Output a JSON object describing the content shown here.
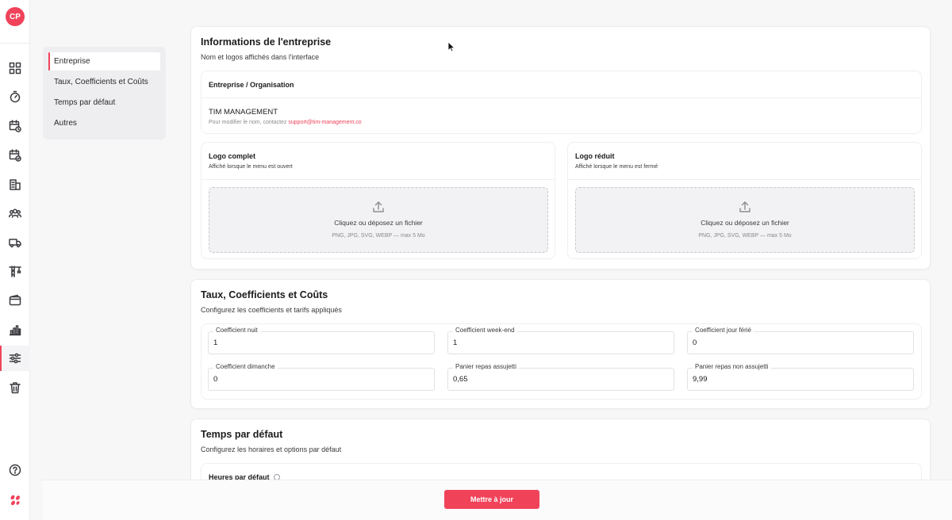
{
  "user": {
    "initials": "CP"
  },
  "rail": {
    "icons": [
      "dashboard-icon",
      "timer-icon",
      "calendar-clock-icon",
      "calendar-check-icon",
      "building-icon",
      "team-icon",
      "truck-icon",
      "crane-icon",
      "wallet-icon",
      "chart-icon",
      "settings-sliders-icon",
      "trash-icon",
      "help-icon",
      "logo-icon"
    ],
    "active": "settings-sliders-icon"
  },
  "subnav": {
    "items": [
      {
        "label": "Entreprise",
        "active": true
      },
      {
        "label": "Taux, Coefficients et Coûts",
        "active": false
      },
      {
        "label": "Temps par défaut",
        "active": false
      },
      {
        "label": "Autres",
        "active": false
      }
    ]
  },
  "company": {
    "title": "Informations de l'entreprise",
    "subtitle": "Nom et logos affichés dans l'interface",
    "org_label": "Entreprise / Organisation",
    "org_name": "TIM MANAGEMENT",
    "contact_prefix": "Pour modifier le nom, contactez ",
    "contact_email": "support@tim-management.co",
    "logo_full": {
      "title": "Logo complet",
      "desc": "Affiché lorsque le menu est ouvert",
      "drop_text": "Cliquez ou déposez un fichier",
      "drop_hint": "PNG, JPG, SVG, WEBP — max 5 Mo"
    },
    "logo_small": {
      "title": "Logo réduit",
      "desc": "Affiché lorsque le menu est fermé",
      "drop_text": "Cliquez ou déposez un fichier",
      "drop_hint": "PNG, JPG, SVG, WEBP — max 5 Mo"
    }
  },
  "rates": {
    "title": "Taux, Coefficients et Coûts",
    "subtitle": "Configurez les coefficients et tarifs appliqués",
    "fields": [
      {
        "label": "Coefficient nuit",
        "value": "1"
      },
      {
        "label": "Coefficient week-end",
        "value": "1"
      },
      {
        "label": "Coefficient jour férié",
        "value": "0"
      },
      {
        "label": "Coefficient dimanche",
        "value": "0"
      },
      {
        "label": "Panier repas assujetti",
        "value": "0,65"
      },
      {
        "label": "Panier repas non assujetti",
        "value": "9,99"
      }
    ]
  },
  "defaults": {
    "title": "Temps par défaut",
    "subtitle": "Configurez les horaires et options par défaut",
    "hours_label": "Heures par défaut"
  },
  "footer": {
    "update_label": "Mettre à jour"
  },
  "colors": {
    "accent": "#f0435a"
  }
}
